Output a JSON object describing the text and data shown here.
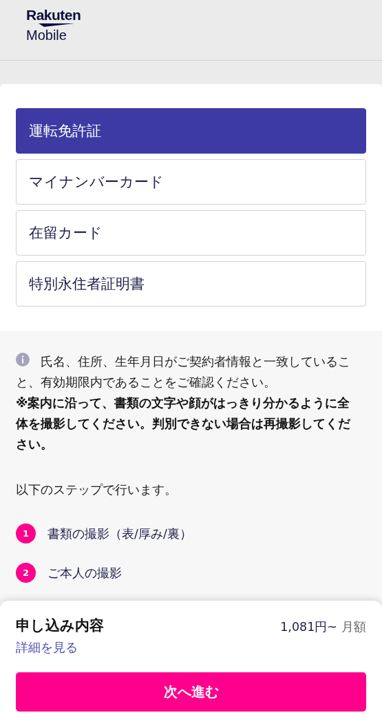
{
  "header": {
    "logo_top": "Rakuten",
    "logo_bottom": "Mobile"
  },
  "documents": [
    {
      "label": "運転免許証",
      "selected": true
    },
    {
      "label": "マイナンバーカード",
      "selected": false
    },
    {
      "label": "在留カード",
      "selected": false
    },
    {
      "label": "特別永住者証明書",
      "selected": false
    }
  ],
  "info": {
    "text": "氏名、住所、生年月日がご契約者情報と一致していること、有効期限内であることをご確認ください。",
    "warning": "※案内に沿って、書類の文字や顔がはっきり分かるように全体を撮影してください。判別できない場合は再撮影してください。"
  },
  "steps_intro": "以下のステップで行います。",
  "steps": [
    {
      "number": "1",
      "label": "書類の撮影（表/厚み/裏）"
    },
    {
      "number": "2",
      "label": "ご本人の撮影"
    }
  ],
  "summary": {
    "title": "申し込み内容",
    "details_link": "詳細を見る",
    "price": "1,081円~",
    "price_unit": "月額",
    "next_button": "次へ進む"
  }
}
